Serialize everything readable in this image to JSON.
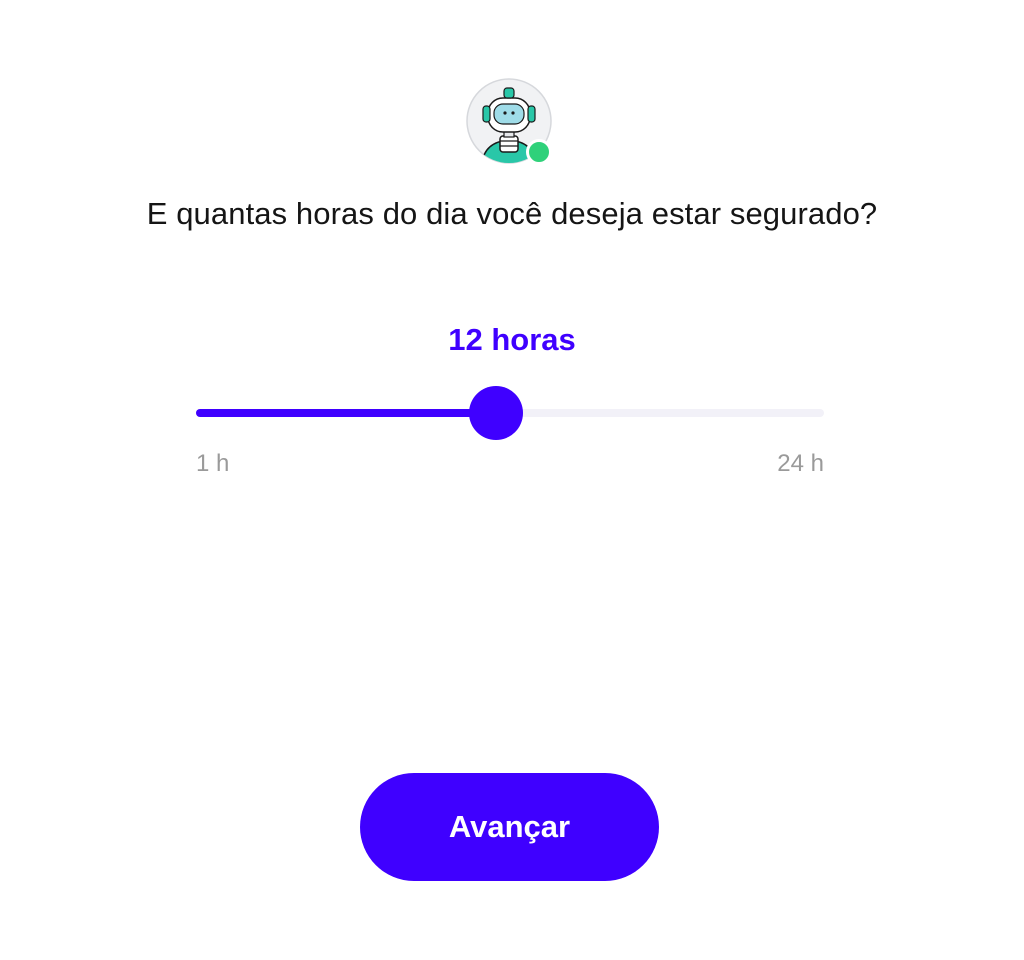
{
  "avatar": {
    "icon": "robot-avatar-icon",
    "status": "online",
    "status_color": "#2fd17a"
  },
  "question": "E quantas horas do dia você deseja estar segurado?",
  "slider": {
    "value_label": "12 horas",
    "value": 12,
    "min": 1,
    "max": 24,
    "min_label": "1 h",
    "max_label": "24 h",
    "accent_color": "#3f00ff"
  },
  "next_button": {
    "label": "Avançar"
  }
}
